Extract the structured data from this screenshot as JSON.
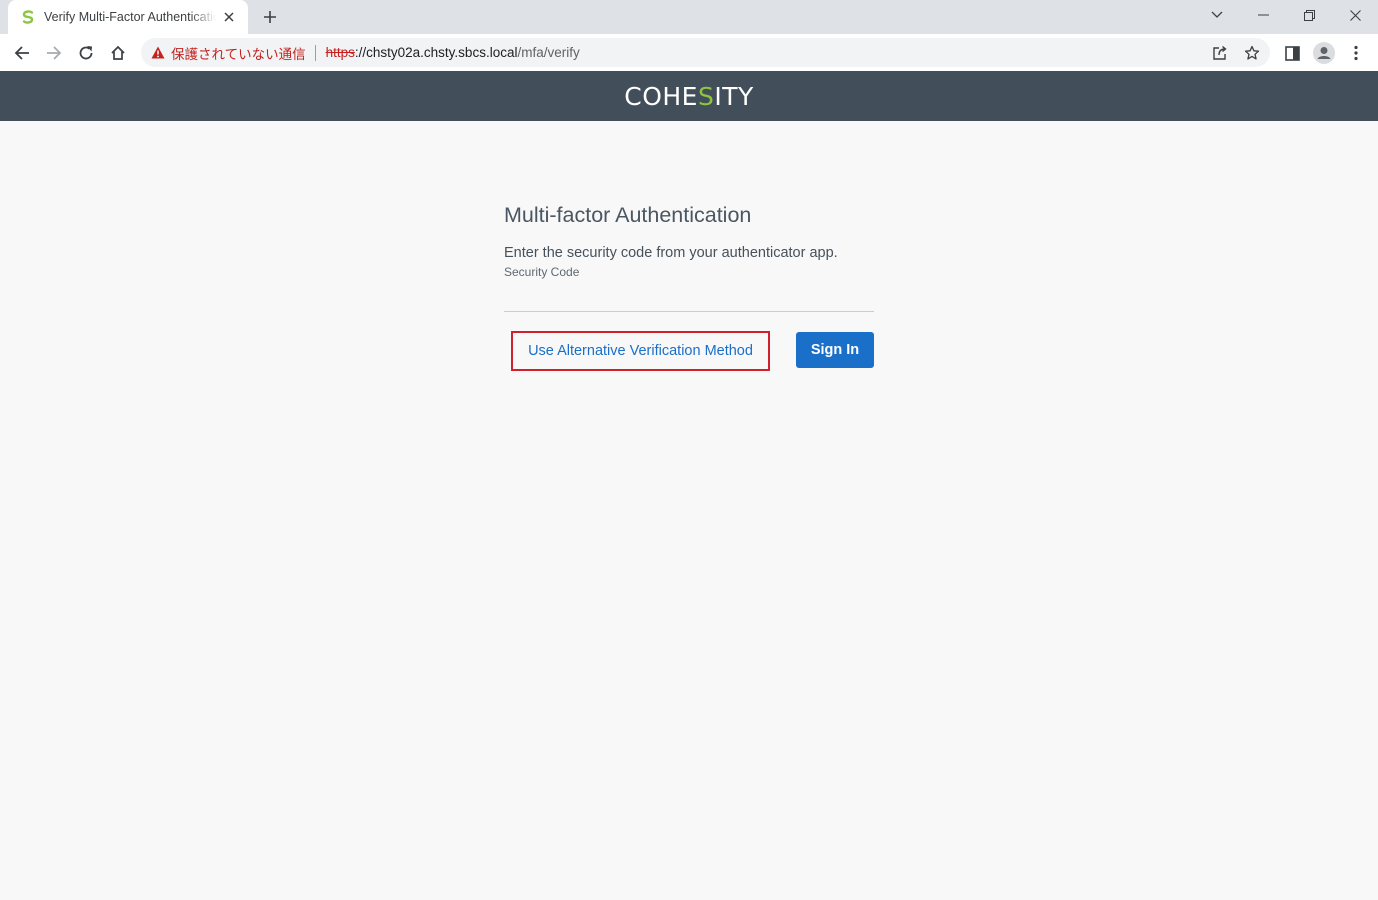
{
  "browser": {
    "tab": {
      "title": "Verify Multi-Factor Authentication"
    },
    "security_label": "保護されていない通信",
    "url": {
      "scheme": "https",
      "host": "://chsty02a.chsty.sbcs.local",
      "path": "/mfa/verify"
    }
  },
  "app": {
    "logo_left": "COHE",
    "logo_accent": "S",
    "logo_right": "ITY",
    "brand_color": "#8cc63f",
    "header_color": "#424e59"
  },
  "mfa": {
    "title": "Multi-factor Authentication",
    "instructions": "Enter the security code from your authenticator app.",
    "field_label": "Security Code",
    "field_value": "",
    "alt_method_label": "Use Alternative Verification Method",
    "sign_in_label": "Sign In",
    "accent_color": "#1a6fc9"
  }
}
